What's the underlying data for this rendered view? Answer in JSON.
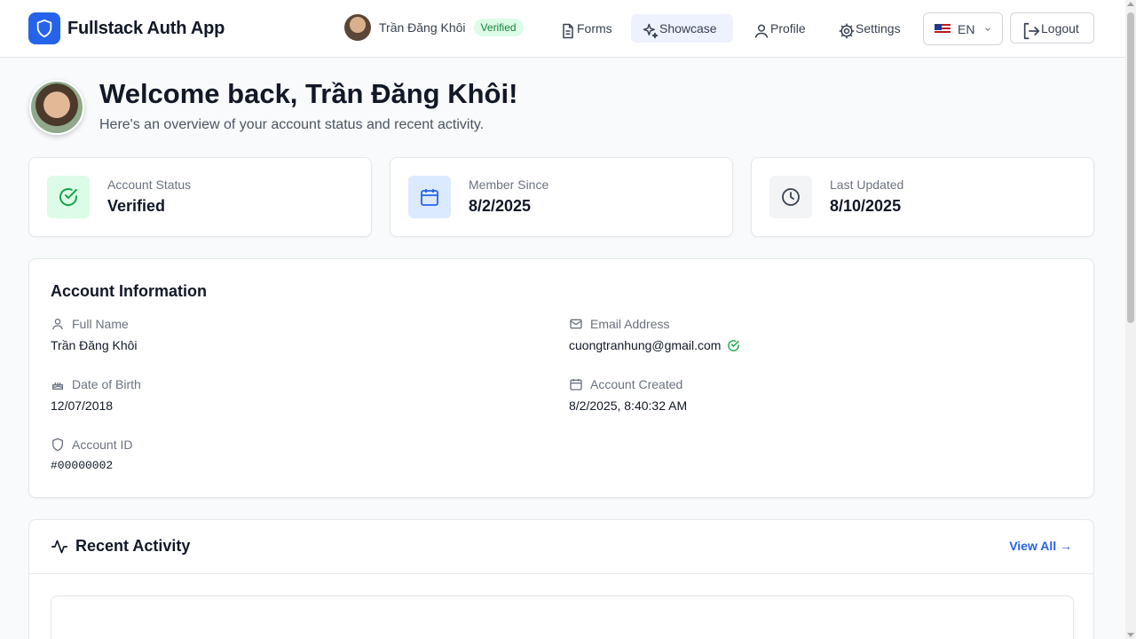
{
  "header": {
    "app_name": "Fullstack Auth App",
    "user_name": "Trần Đăng Khôi",
    "verified_badge": "Verified",
    "nav": {
      "forms": "Forms",
      "showcase": "Showcase",
      "profile": "Profile",
      "settings": "Settings"
    },
    "language": "EN",
    "logout": "Logout"
  },
  "welcome": {
    "title": "Welcome back, Trần Đăng Khôi!",
    "subtitle": "Here's an overview of your account status and recent activity."
  },
  "stats": [
    {
      "label": "Account Status",
      "value": "Verified",
      "icon": "check-circle-icon",
      "color": "#16a34a",
      "bg": "#dcfce7"
    },
    {
      "label": "Member Since",
      "value": "8/2/2025",
      "icon": "calendar-icon",
      "color": "#2563eb",
      "bg": "#dbeafe"
    },
    {
      "label": "Last Updated",
      "value": "8/10/2025",
      "icon": "clock-icon",
      "color": "#374151",
      "bg": "#f3f4f6"
    }
  ],
  "account_info": {
    "title": "Account Information",
    "full_name_label": "Full Name",
    "full_name": "Trần Đăng Khôi",
    "email_label": "Email Address",
    "email": "cuongtranhung@gmail.com",
    "dob_label": "Date of Birth",
    "dob": "12/07/2018",
    "created_label": "Account Created",
    "created": "8/2/2025, 8:40:32 AM",
    "id_label": "Account ID",
    "id": "#00000002"
  },
  "activity": {
    "title": "Recent Activity",
    "view_all": "View All →"
  },
  "colors": {
    "primary": "#2563eb",
    "success": "#16a34a",
    "background": "#f9fafb"
  }
}
